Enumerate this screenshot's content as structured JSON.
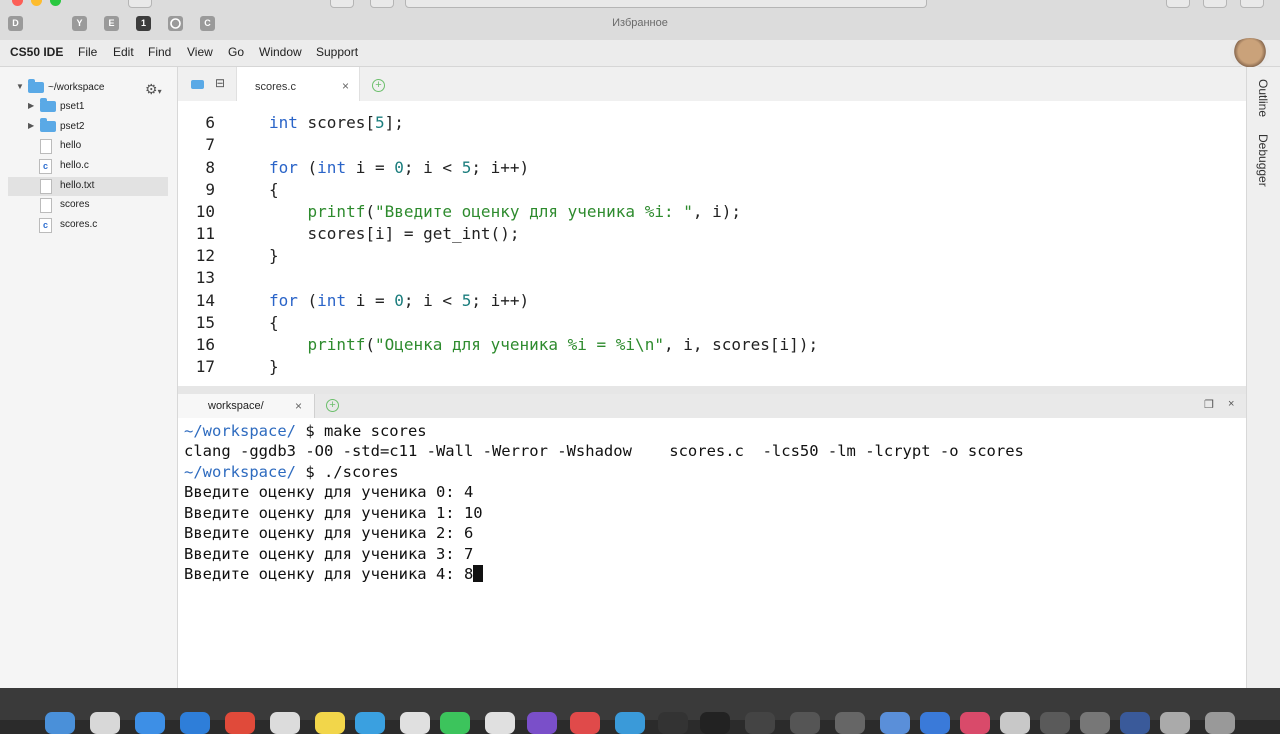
{
  "browser": {
    "favorites_label": "Избранное",
    "bookmarks": [
      "D",
      "Y",
      "E",
      "1",
      "",
      "C"
    ]
  },
  "menubar": {
    "brand": "CS50 IDE",
    "items": [
      "File",
      "Edit",
      "Find",
      "View",
      "Go",
      "Window",
      "Support"
    ]
  },
  "tree": {
    "root": "~/workspace",
    "items": [
      {
        "label": "pset1",
        "type": "folder"
      },
      {
        "label": "pset2",
        "type": "folder"
      },
      {
        "label": "hello",
        "type": "file"
      },
      {
        "label": "hello.c",
        "type": "c-file"
      },
      {
        "label": "hello.txt",
        "type": "file",
        "selected": true
      },
      {
        "label": "scores",
        "type": "file"
      },
      {
        "label": "scores.c",
        "type": "c-file"
      }
    ]
  },
  "editor": {
    "tab_label": "scores.c",
    "line_numbers": [
      "6",
      "7",
      "8",
      "9",
      "10",
      "11",
      "12",
      "13",
      "14",
      "15",
      "16",
      "17"
    ],
    "lines": [
      "    int scores[5];",
      "",
      "    for (int i = 0; i < 5; i++)",
      "    {",
      "        printf(\"Введите оценку для ученика %i: \", i);",
      "        scores[i] = get_int();",
      "    }",
      "",
      "    for (int i = 0; i < 5; i++)",
      "    {",
      "        printf(\"Оценка для ученика %i = %i\\n\", i, scores[i]);",
      "    }"
    ]
  },
  "right_panel": {
    "outline": "Outline",
    "debugger": "Debugger"
  },
  "terminal": {
    "tab_label": "workspace/",
    "prompt": "~/workspace/",
    "lines": [
      {
        "prompt": "~/workspace/",
        "text": " $ make scores"
      },
      {
        "prompt": "",
        "text": "clang -ggdb3 -O0 -std=c11 -Wall -Werror -Wshadow    scores.c  -lcs50 -lm -lcrypt -o scores"
      },
      {
        "prompt": "~/workspace/",
        "text": " $ ./scores"
      },
      {
        "prompt": "",
        "text": "Введите оценку для ученика 0: 4"
      },
      {
        "prompt": "",
        "text": "Введите оценку для ученика 1: 10"
      },
      {
        "prompt": "",
        "text": "Введите оценку для ученика 2: 6"
      },
      {
        "prompt": "",
        "text": "Введите оценку для ученика 3: 7"
      },
      {
        "prompt": "",
        "text": "Введите оценку для ученика 4: 8"
      }
    ]
  },
  "colors": {
    "keyword": "#2a64c8",
    "string": "#2e8b2e",
    "number": "#1b7d7d",
    "prompt": "#2e6bbf"
  }
}
